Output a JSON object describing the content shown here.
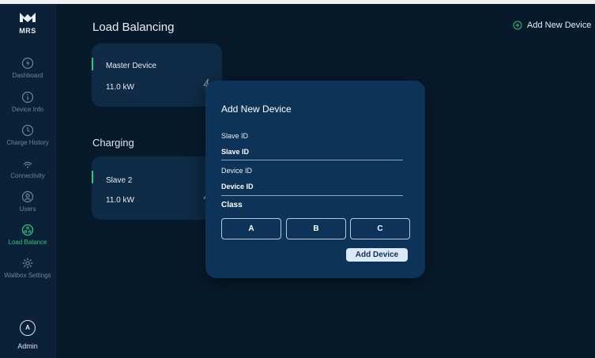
{
  "brand": {
    "logo_text": "MRS"
  },
  "sidebar": {
    "items": [
      {
        "label": "Dashboard",
        "icon": "dashboard-icon"
      },
      {
        "label": "Device Info",
        "icon": "info-icon"
      },
      {
        "label": "Charge History",
        "icon": "clock-icon"
      },
      {
        "label": "Connectivity",
        "icon": "wifi-icon"
      },
      {
        "label": "Users",
        "icon": "user-icon"
      },
      {
        "label": "Load Balance",
        "icon": "load-balance-icon",
        "active": true
      },
      {
        "label": "Wallbox Settings",
        "icon": "gear-icon"
      }
    ],
    "user": {
      "initial": "A",
      "label": "Admin"
    }
  },
  "header": {
    "title": "Load Balancing",
    "add_label": "Add New Device"
  },
  "master": {
    "name": "Master Device",
    "power": "11.0 kW"
  },
  "charging": {
    "title": "Charging",
    "slave": {
      "name": "Slave 2",
      "power": "11.0 kW"
    }
  },
  "modal": {
    "title": "Add New Device",
    "slave_id_label": "Slave ID",
    "slave_id_value": "Slave ID",
    "device_id_label": "Device ID",
    "device_id_value": "Device ID",
    "class_label": "Class",
    "class_options": [
      "A",
      "B",
      "C"
    ],
    "submit_label": "Add Device"
  },
  "colors": {
    "background": "#071a2c",
    "sidebar": "#0b2138",
    "card": "#0f2b46",
    "modal": "#0e3358",
    "accent": "#2fc27a"
  }
}
